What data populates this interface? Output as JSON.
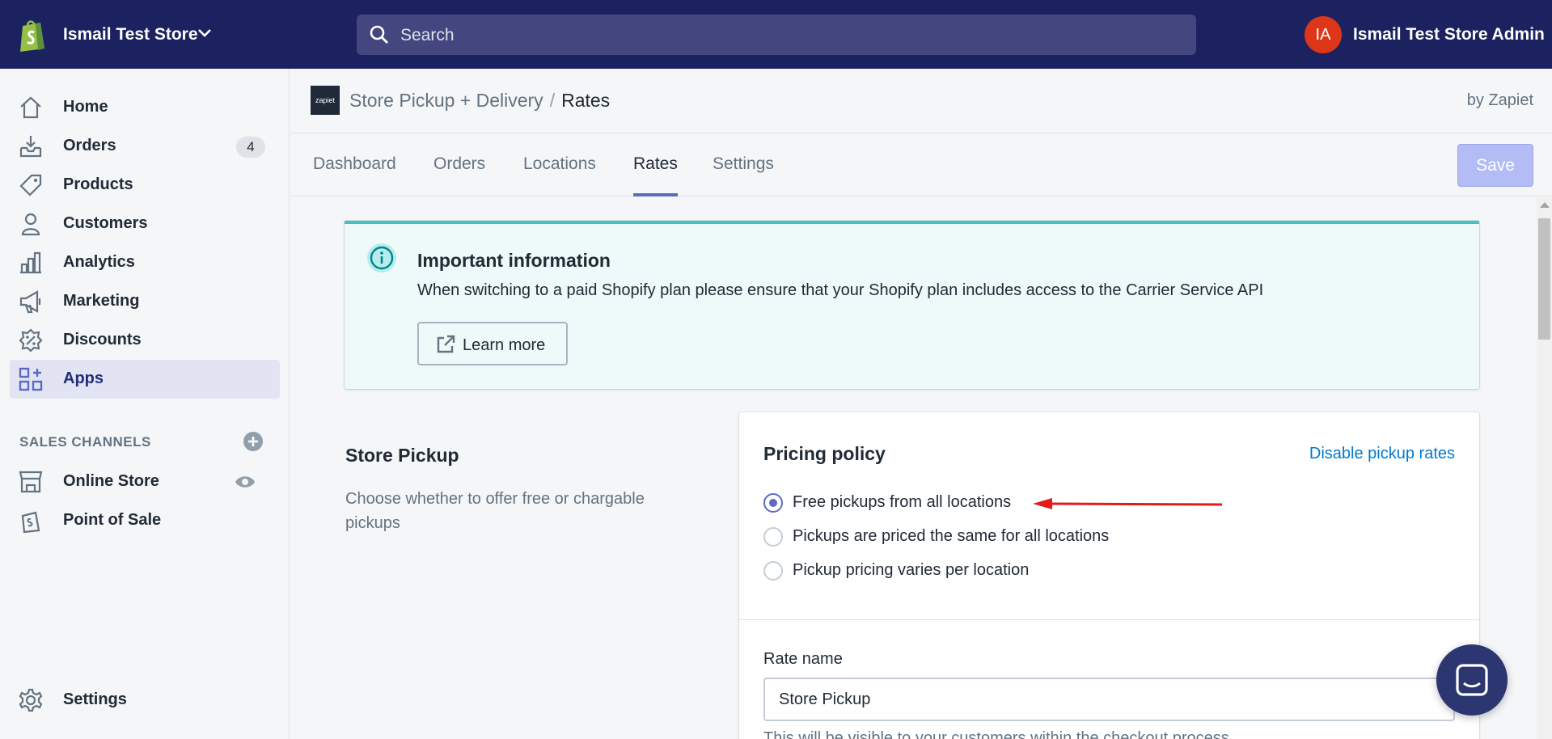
{
  "topbar": {
    "store_name": "Ismail Test Store",
    "search_placeholder": "Search",
    "avatar_initials": "IA",
    "admin_name": "Ismail Test Store Admin",
    "colors": {
      "background": "#1c2260",
      "avatar": "#de3618",
      "search": "#43467f"
    }
  },
  "sidebar": {
    "items": [
      {
        "label": "Home",
        "icon": "home-icon"
      },
      {
        "label": "Orders",
        "icon": "orders-icon",
        "badge": "4"
      },
      {
        "label": "Products",
        "icon": "tag-icon"
      },
      {
        "label": "Customers",
        "icon": "person-icon"
      },
      {
        "label": "Analytics",
        "icon": "bar-chart-icon"
      },
      {
        "label": "Marketing",
        "icon": "megaphone-icon"
      },
      {
        "label": "Discounts",
        "icon": "discount-icon"
      },
      {
        "label": "Apps",
        "icon": "apps-icon",
        "active": true
      }
    ],
    "sales_channels_heading": "SALES CHANNELS",
    "channels": [
      {
        "label": "Online Store",
        "icon": "store-icon"
      },
      {
        "label": "Point of Sale",
        "icon": "pos-bag-icon"
      }
    ],
    "settings_label": "Settings"
  },
  "app_header": {
    "logo_text": "zapiet",
    "app_name": "Store Pickup + Delivery",
    "separator": "/",
    "current_page": "Rates",
    "byline": "by Zapiet"
  },
  "tabs": [
    {
      "label": "Dashboard",
      "active": false
    },
    {
      "label": "Orders",
      "active": false
    },
    {
      "label": "Locations",
      "active": false
    },
    {
      "label": "Rates",
      "active": true
    },
    {
      "label": "Settings",
      "active": false
    }
  ],
  "save_button": {
    "label": "Save",
    "disabled": true
  },
  "banner": {
    "title": "Important information",
    "text": "When switching to a paid Shopify plan please ensure that your Shopify plan includes access to the Carrier Service API",
    "button_label": "Learn more",
    "accent_color": "#47c1bf"
  },
  "store_pickup": {
    "title": "Store Pickup",
    "description": "Choose whether to offer free or chargable pickups"
  },
  "pricing_card": {
    "title": "Pricing policy",
    "disable_link": "Disable pickup rates",
    "options": [
      {
        "label": "Free pickups from all locations",
        "checked": true
      },
      {
        "label": "Pickups are priced the same for all locations",
        "checked": false
      },
      {
        "label": "Pickup pricing varies per location",
        "checked": false
      }
    ],
    "rate_name_label": "Rate name",
    "rate_name_value": "Store Pickup",
    "rate_name_help": "This will be visible to your customers within the checkout process"
  }
}
